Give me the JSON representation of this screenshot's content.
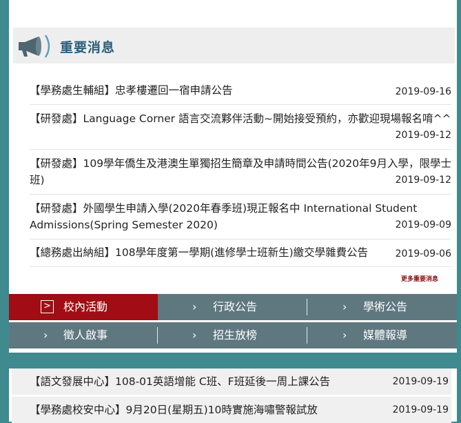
{
  "news": {
    "title": "重要消息",
    "items": [
      {
        "text": "【學務處生輔組】忠孝樓遷回一宿申請公告",
        "date": "2019-09-16"
      },
      {
        "text": "【研發處】Language Corner 語言交流夥伴活動~開始接受預約，亦歡迎現場報名唷^^",
        "date": "2019-09-12"
      },
      {
        "text": "【研發處】109學年僑生及港澳生單獨招生簡章及申請時間公告(2020年9月入學，限學士班)",
        "date": "2019-09-12"
      },
      {
        "text": "【研發處】外國學生申請入學(2020年春季班)現正報名中 International Student Admissions(Spring Semester 2020)",
        "date": "2019-09-09"
      },
      {
        "text": "【總務處出納組】108學年度第一學期(進修學士班新生)繳交學雜費公告",
        "date": "2019-09-06"
      }
    ],
    "more_label": "更多重要消息",
    "megaphone_icon": "megaphone-icon"
  },
  "tabs": [
    {
      "label": "校內活動",
      "active": true
    },
    {
      "label": "行政公告",
      "active": false
    },
    {
      "label": "學術公告",
      "active": false
    },
    {
      "label": "徵人啟事",
      "active": false
    },
    {
      "label": "招生放榜",
      "active": false
    },
    {
      "label": "媒體報導",
      "active": false
    }
  ],
  "activities": {
    "items": [
      {
        "text": "【語文發展中心】108-01英語增能 C班、F班延後一周上課公告",
        "date": "2019-09-19"
      },
      {
        "text": "【學務處校安中心】9月20日(星期五)10時實施海嘯警報試放",
        "date": "2019-09-19"
      }
    ]
  },
  "colors": {
    "background": "#3e8a8e",
    "title": "#2b5e7a",
    "active_tab": "#a10d14",
    "tab": "#5f7880",
    "more_link": "#8a1010"
  }
}
